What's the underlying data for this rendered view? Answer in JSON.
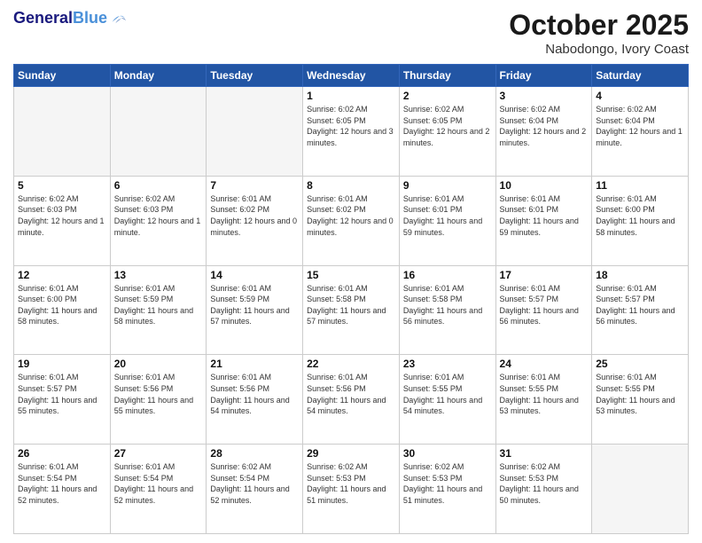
{
  "header": {
    "logo_line1": "General",
    "logo_line2": "Blue",
    "month": "October 2025",
    "location": "Nabodongo, Ivory Coast"
  },
  "weekdays": [
    "Sunday",
    "Monday",
    "Tuesday",
    "Wednesday",
    "Thursday",
    "Friday",
    "Saturday"
  ],
  "weeks": [
    [
      {
        "num": "",
        "info": ""
      },
      {
        "num": "",
        "info": ""
      },
      {
        "num": "",
        "info": ""
      },
      {
        "num": "1",
        "info": "Sunrise: 6:02 AM\nSunset: 6:05 PM\nDaylight: 12 hours and 3 minutes."
      },
      {
        "num": "2",
        "info": "Sunrise: 6:02 AM\nSunset: 6:05 PM\nDaylight: 12 hours and 2 minutes."
      },
      {
        "num": "3",
        "info": "Sunrise: 6:02 AM\nSunset: 6:04 PM\nDaylight: 12 hours and 2 minutes."
      },
      {
        "num": "4",
        "info": "Sunrise: 6:02 AM\nSunset: 6:04 PM\nDaylight: 12 hours and 1 minute."
      }
    ],
    [
      {
        "num": "5",
        "info": "Sunrise: 6:02 AM\nSunset: 6:03 PM\nDaylight: 12 hours and 1 minute."
      },
      {
        "num": "6",
        "info": "Sunrise: 6:02 AM\nSunset: 6:03 PM\nDaylight: 12 hours and 1 minute."
      },
      {
        "num": "7",
        "info": "Sunrise: 6:01 AM\nSunset: 6:02 PM\nDaylight: 12 hours and 0 minutes."
      },
      {
        "num": "8",
        "info": "Sunrise: 6:01 AM\nSunset: 6:02 PM\nDaylight: 12 hours and 0 minutes."
      },
      {
        "num": "9",
        "info": "Sunrise: 6:01 AM\nSunset: 6:01 PM\nDaylight: 11 hours and 59 minutes."
      },
      {
        "num": "10",
        "info": "Sunrise: 6:01 AM\nSunset: 6:01 PM\nDaylight: 11 hours and 59 minutes."
      },
      {
        "num": "11",
        "info": "Sunrise: 6:01 AM\nSunset: 6:00 PM\nDaylight: 11 hours and 58 minutes."
      }
    ],
    [
      {
        "num": "12",
        "info": "Sunrise: 6:01 AM\nSunset: 6:00 PM\nDaylight: 11 hours and 58 minutes."
      },
      {
        "num": "13",
        "info": "Sunrise: 6:01 AM\nSunset: 5:59 PM\nDaylight: 11 hours and 58 minutes."
      },
      {
        "num": "14",
        "info": "Sunrise: 6:01 AM\nSunset: 5:59 PM\nDaylight: 11 hours and 57 minutes."
      },
      {
        "num": "15",
        "info": "Sunrise: 6:01 AM\nSunset: 5:58 PM\nDaylight: 11 hours and 57 minutes."
      },
      {
        "num": "16",
        "info": "Sunrise: 6:01 AM\nSunset: 5:58 PM\nDaylight: 11 hours and 56 minutes."
      },
      {
        "num": "17",
        "info": "Sunrise: 6:01 AM\nSunset: 5:57 PM\nDaylight: 11 hours and 56 minutes."
      },
      {
        "num": "18",
        "info": "Sunrise: 6:01 AM\nSunset: 5:57 PM\nDaylight: 11 hours and 56 minutes."
      }
    ],
    [
      {
        "num": "19",
        "info": "Sunrise: 6:01 AM\nSunset: 5:57 PM\nDaylight: 11 hours and 55 minutes."
      },
      {
        "num": "20",
        "info": "Sunrise: 6:01 AM\nSunset: 5:56 PM\nDaylight: 11 hours and 55 minutes."
      },
      {
        "num": "21",
        "info": "Sunrise: 6:01 AM\nSunset: 5:56 PM\nDaylight: 11 hours and 54 minutes."
      },
      {
        "num": "22",
        "info": "Sunrise: 6:01 AM\nSunset: 5:56 PM\nDaylight: 11 hours and 54 minutes."
      },
      {
        "num": "23",
        "info": "Sunrise: 6:01 AM\nSunset: 5:55 PM\nDaylight: 11 hours and 54 minutes."
      },
      {
        "num": "24",
        "info": "Sunrise: 6:01 AM\nSunset: 5:55 PM\nDaylight: 11 hours and 53 minutes."
      },
      {
        "num": "25",
        "info": "Sunrise: 6:01 AM\nSunset: 5:55 PM\nDaylight: 11 hours and 53 minutes."
      }
    ],
    [
      {
        "num": "26",
        "info": "Sunrise: 6:01 AM\nSunset: 5:54 PM\nDaylight: 11 hours and 52 minutes."
      },
      {
        "num": "27",
        "info": "Sunrise: 6:01 AM\nSunset: 5:54 PM\nDaylight: 11 hours and 52 minutes."
      },
      {
        "num": "28",
        "info": "Sunrise: 6:02 AM\nSunset: 5:54 PM\nDaylight: 11 hours and 52 minutes."
      },
      {
        "num": "29",
        "info": "Sunrise: 6:02 AM\nSunset: 5:53 PM\nDaylight: 11 hours and 51 minutes."
      },
      {
        "num": "30",
        "info": "Sunrise: 6:02 AM\nSunset: 5:53 PM\nDaylight: 11 hours and 51 minutes."
      },
      {
        "num": "31",
        "info": "Sunrise: 6:02 AM\nSunset: 5:53 PM\nDaylight: 11 hours and 50 minutes."
      },
      {
        "num": "",
        "info": ""
      }
    ]
  ]
}
